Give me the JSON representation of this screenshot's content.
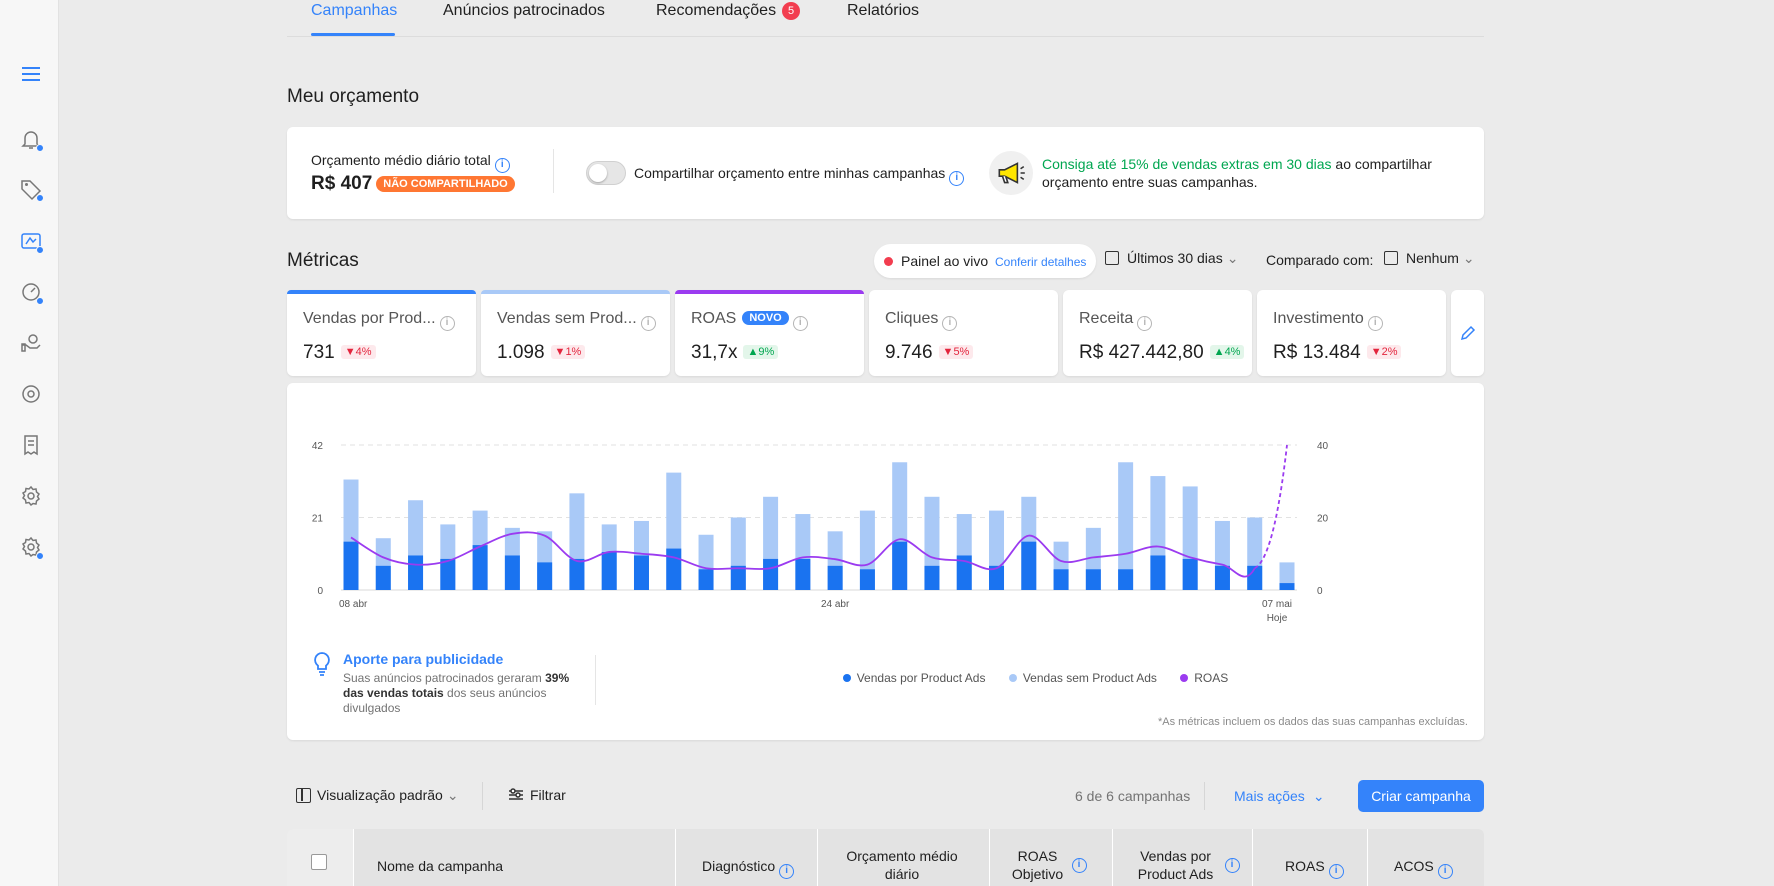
{
  "tabs": [
    {
      "label": "Campanhas",
      "active": true
    },
    {
      "label": "Anúncios patrocinados"
    },
    {
      "label": "Recomendações",
      "badge": "5"
    },
    {
      "label": "Relatórios"
    }
  ],
  "budget": {
    "title": "Meu orçamento",
    "avg_label": "Orçamento médio diário total",
    "avg_value": "R$ 407",
    "not_shared": "NÃO COMPARTILHADO",
    "share_label": "Compartilhar orçamento entre minhas campanhas",
    "promo_highlight": "Consiga até 15% de vendas extras em 30 dias",
    "promo_rest": " ao compartilhar orçamento entre suas campanhas."
  },
  "metrics": {
    "title": "Métricas",
    "live_label": "Painel ao vivo",
    "live_link": "Conferir detalhes",
    "period": "Últimos 30 dias",
    "compare_label": "Comparado com:",
    "compare_value": "Nenhum",
    "cards": [
      {
        "label": "Vendas por Prod...",
        "value": "731",
        "change": "4%",
        "dir": "down",
        "bar": "#3483fa"
      },
      {
        "label": "Vendas sem Prod...",
        "value": "1.098",
        "change": "1%",
        "dir": "down",
        "bar": "#a9c9f7"
      },
      {
        "label": "ROAS",
        "badge": "NOVO",
        "value": "31,7x",
        "change": "9%",
        "dir": "up",
        "bar": "#9b3bf0"
      },
      {
        "label": "Cliques",
        "value": "9.746",
        "change": "5%",
        "dir": "down"
      },
      {
        "label": "Receita",
        "value": "R$ 427.442,80",
        "change": "4%",
        "dir": "up"
      },
      {
        "label": "Investimento",
        "value": "R$ 13.484",
        "change": "2%",
        "dir": "down"
      }
    ]
  },
  "chart_data": {
    "type": "bar",
    "x_labels": [
      "08 abr",
      "24 abr",
      "07 mai"
    ],
    "x_sublabel": "Hoje",
    "y_left_ticks": [
      0,
      21,
      42
    ],
    "y_right_ticks": [
      0,
      20,
      40
    ],
    "ylim_left": [
      0,
      42
    ],
    "ylim_right": [
      0,
      40
    ],
    "series": [
      {
        "name": "Vendas por Product Ads",
        "color": "#1a73f0",
        "values": [
          14,
          7,
          10,
          9,
          13,
          10,
          8,
          9,
          11,
          10,
          12,
          6,
          7,
          9,
          9,
          7,
          6,
          14,
          7,
          10,
          7,
          14,
          6,
          6,
          6,
          10,
          9,
          7,
          7,
          2
        ]
      },
      {
        "name": "Vendas sem Product Ads",
        "color": "#a9c9f7",
        "values": [
          32,
          15,
          26,
          19,
          23,
          18,
          17,
          28,
          19,
          20,
          34,
          16,
          21,
          27,
          22,
          17,
          23,
          37,
          27,
          22,
          23,
          27,
          14,
          18,
          37,
          33,
          30,
          20,
          21,
          8
        ]
      },
      {
        "name": "ROAS",
        "color": "#9b3bf0",
        "values": [
          14.5,
          9,
          7,
          8,
          12,
          15.5,
          15,
          8,
          10.5,
          10,
          9,
          6,
          6,
          6,
          9,
          8.5,
          7,
          14,
          9,
          8,
          6,
          15,
          8,
          9,
          10,
          12,
          9,
          7,
          6,
          40
        ]
      }
    ],
    "legend": "bottom-center",
    "grid": true
  },
  "insight": {
    "title": "Aporte para publicidade",
    "text_1": "Suas anúncios patrocinados geraram ",
    "pct": "39%",
    "text_2": " das vendas totais",
    "text_3": " dos seus anúncios divulgados"
  },
  "chart_note": "*As métricas incluem os dados das suas campanhas excluídas.",
  "toolbar": {
    "view": "Visualização padrão",
    "filter": "Filtrar",
    "count": "6 de 6 campanhas",
    "more": "Mais ações",
    "create": "Criar campanha"
  },
  "table_headers": {
    "name": "Nome da campanha",
    "diag": "Diagnóstico",
    "budget": "Orçamento médio diário",
    "roas_obj": "ROAS Objetivo",
    "sales_pads": "Vendas por Product Ads",
    "roas": "ROAS",
    "acos": "ACOS"
  }
}
